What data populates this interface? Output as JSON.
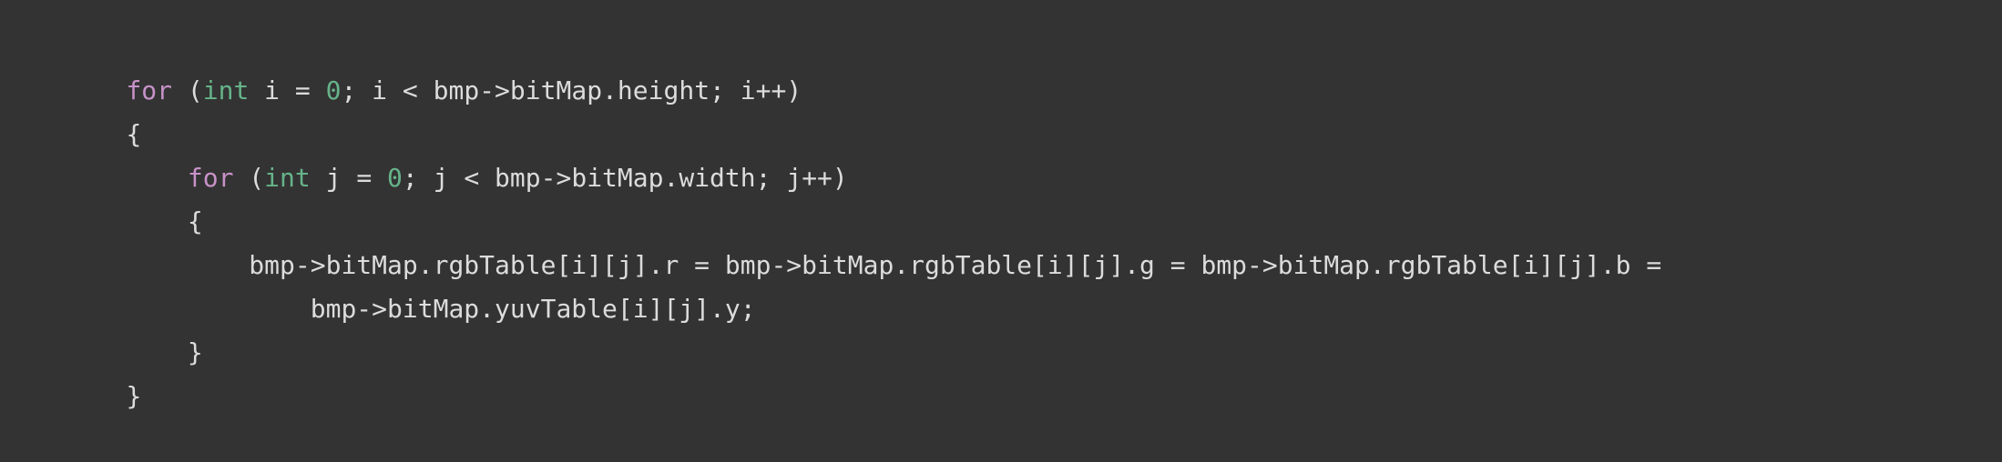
{
  "code": {
    "lines": [
      {
        "tokens": [
          {
            "t": "keyword",
            "text": "for"
          },
          {
            "t": "plain",
            "text": " ("
          },
          {
            "t": "type",
            "text": "int"
          },
          {
            "t": "plain",
            "text": " i = "
          },
          {
            "t": "number",
            "text": "0"
          },
          {
            "t": "plain",
            "text": "; i < bmp->bitMap.height; i++)"
          }
        ]
      },
      {
        "tokens": [
          {
            "t": "plain",
            "text": "{"
          }
        ]
      },
      {
        "tokens": [
          {
            "t": "plain",
            "text": "    "
          },
          {
            "t": "keyword",
            "text": "for"
          },
          {
            "t": "plain",
            "text": " ("
          },
          {
            "t": "type",
            "text": "int"
          },
          {
            "t": "plain",
            "text": " j = "
          },
          {
            "t": "number",
            "text": "0"
          },
          {
            "t": "plain",
            "text": "; j < bmp->bitMap.width; j++)"
          }
        ]
      },
      {
        "tokens": [
          {
            "t": "plain",
            "text": "    {"
          }
        ]
      },
      {
        "tokens": [
          {
            "t": "plain",
            "text": "        bmp->bitMap.rgbTable[i][j].r = bmp->bitMap.rgbTable[i][j].g = bmp->bitMap.rgbTable[i][j].b ="
          }
        ]
      },
      {
        "tokens": [
          {
            "t": "plain",
            "text": "            bmp->bitMap.yuvTable[i][j].y;"
          }
        ]
      },
      {
        "tokens": [
          {
            "t": "plain",
            "text": "    }"
          }
        ]
      },
      {
        "tokens": [
          {
            "t": "plain",
            "text": "}"
          }
        ]
      }
    ]
  },
  "colors": {
    "background": "#333333",
    "keyword": "#c792c8",
    "type": "#66b389",
    "number": "#66b389",
    "text": "#dcdcdc"
  }
}
